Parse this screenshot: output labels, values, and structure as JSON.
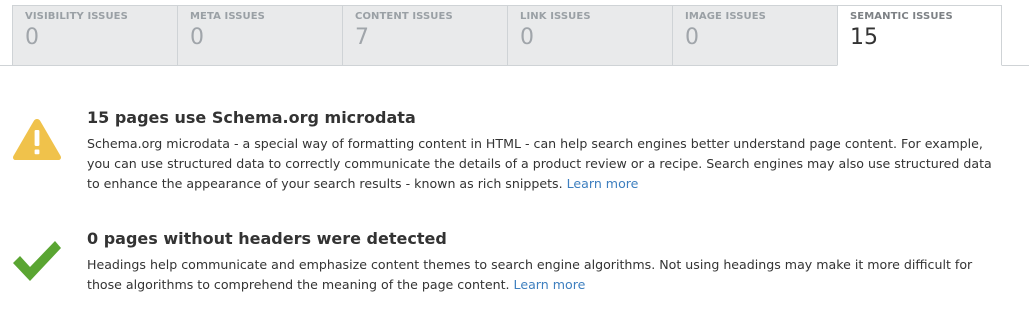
{
  "tabs": [
    {
      "label": "VISIBILITY ISSUES",
      "count": "0"
    },
    {
      "label": "META ISSUES",
      "count": "0"
    },
    {
      "label": "CONTENT ISSUES",
      "count": "7"
    },
    {
      "label": "LINK ISSUES",
      "count": "0"
    },
    {
      "label": "IMAGE ISSUES",
      "count": "0"
    },
    {
      "label": "SEMANTIC ISSUES",
      "count": "15"
    }
  ],
  "active_tab": "SEMANTIC ISSUES",
  "issues": [
    {
      "icon": "warning-icon",
      "title": "15 pages use Schema.org microdata",
      "text": "Schema.org microdata - a special way of formatting content in HTML - can help search engines better understand page content. For example, you can use structured data to correctly communicate the details of a product review or a recipe. Search engines may also use structured data to enhance the appearance of your search results - known as rich snippets.",
      "link": "Learn more"
    },
    {
      "icon": "checkmark-icon",
      "title": "0 pages without headers were detected",
      "text": "Headings help communicate and emphasize content themes to search engine algorithms. Not using headings may make it more difficult for those algorithms to comprehend the meaning of the page content.",
      "link": "Learn more"
    }
  ],
  "colors": {
    "warning": "#f0c24b",
    "success": "#5aa532",
    "link": "#3e7fbf"
  }
}
